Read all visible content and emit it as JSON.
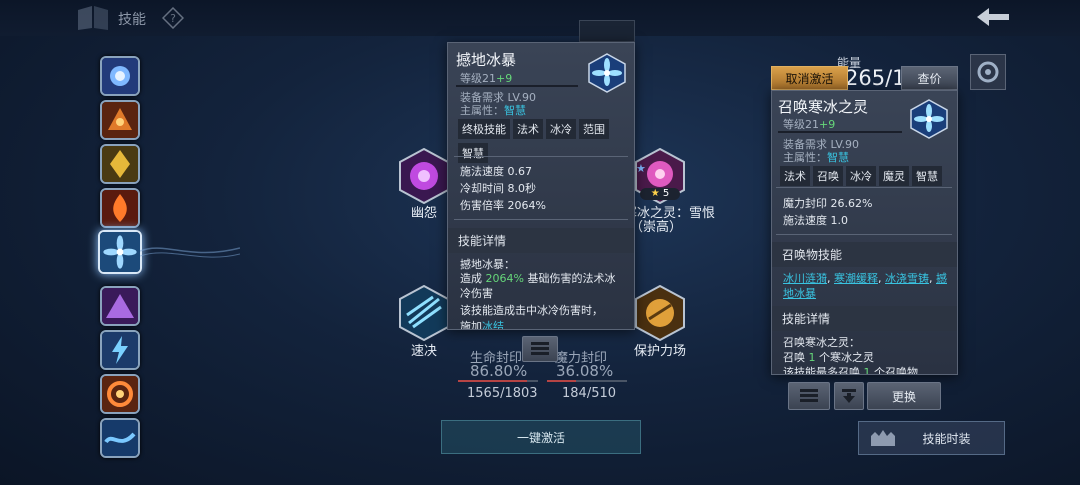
{
  "top": {
    "title": "技能"
  },
  "left_rail": {
    "active_index": 4,
    "count": 9
  },
  "nodes": [
    {
      "label": "幽怨"
    },
    {
      "label_line1": "寒冰之灵：雪恨",
      "label_line2": "（崇高）",
      "stars": "5"
    },
    {
      "label": "速决"
    },
    {
      "label": "保护力场"
    }
  ],
  "stats": {
    "life": {
      "label": "生命封印",
      "percent": "86.80%",
      "fraction": "1565/1803",
      "fill": 0.868
    },
    "mana": {
      "label": "魔力封印",
      "percent": "36.08%",
      "fraction": "184/510",
      "fill": 0.3608
    }
  },
  "energy": {
    "label": "能量",
    "value": "265/1"
  },
  "tooltip_left": {
    "name": "撼地冰暴",
    "level_prefix": "等级21",
    "level_bonus": "+9",
    "req": "装备需求 LV.90",
    "attr_label": "主属性：",
    "attr_value": "智慧",
    "tags": [
      "终极技能",
      "法术",
      "冰冷",
      "范围",
      "智慧"
    ],
    "stats": [
      "施法速度 0.67",
      "冷却时间 8.0秒",
      "伤害倍率 2064%"
    ],
    "detail_header": "技能详情",
    "detail_title": "撼地冰暴：",
    "detail_p1a": "造成 ",
    "detail_p1b": "2064%",
    "detail_p1c": " 基础伤害的法术冰冷伤害",
    "detail_p2": "该技能造成击中冰冷伤害时，",
    "detail_p3a": "施加",
    "detail_p3b": "冰结"
  },
  "tooltip_right": {
    "name": "召唤寒冰之灵",
    "level_prefix": "等级21",
    "level_bonus": "+9",
    "req": "装备需求 LV.90",
    "attr_label": "主属性：",
    "attr_value": "智慧",
    "tags": [
      "法术",
      "召唤",
      "冰冷",
      "魔灵",
      "智慧"
    ],
    "stats": [
      "魔力封印 26.62%",
      "施法速度 1.0"
    ],
    "summon_header": "召唤物技能",
    "summon_links": [
      "冰川涟漪",
      "寒潮缓释",
      "冰浇雪铸",
      "撼地冰暴"
    ],
    "detail_header": "技能详情",
    "detail_title": "召唤寒冰之灵：",
    "detail_p1a": "召唤 ",
    "detail_p1b": "1",
    "detail_p1c": " 个寒冰之灵",
    "detail_p2a": "该技能最多召唤 ",
    "detail_p2b": "1",
    "detail_p2c": " 个召唤物"
  },
  "buttons": {
    "cancel": "取消激活",
    "inspect": "查价",
    "replace": "更换",
    "activate_all": "一键激活",
    "skill_skin": "技能时装"
  }
}
